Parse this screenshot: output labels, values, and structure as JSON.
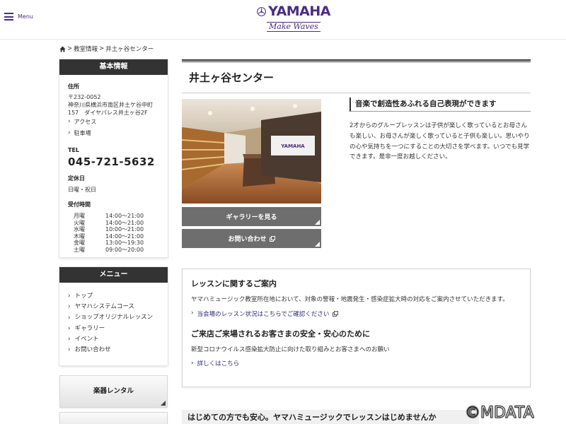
{
  "header": {
    "menu_label": "Menu",
    "logo_text": "YAMAHA",
    "logo_tagline": "Make Waves"
  },
  "breadcrumb": {
    "sep1": ">",
    "item1": "教室情報",
    "sep2": ">",
    "item2": "井土ヶ谷センター"
  },
  "sidebar": {
    "info_heading": "基本情報",
    "address_label": "住所",
    "address_lines": [
      "〒232-0052",
      "神奈川県横浜市南区井土ケ谷中町",
      "157　ダイヤパレス井土ヶ谷2F"
    ],
    "access_link": "アクセス",
    "parking_link": "駐車場",
    "tel_label": "TEL",
    "tel": "045-721-5632",
    "closed_label": "定休日",
    "closed_value": "日曜・祝日",
    "hours_label": "受付時間",
    "hours": [
      {
        "day": "月曜",
        "time": "14:00〜21:00"
      },
      {
        "day": "火曜",
        "time": "14:00〜21:00"
      },
      {
        "day": "水曜",
        "time": "10:00〜21:00"
      },
      {
        "day": "木曜",
        "time": "14:00〜21:00"
      },
      {
        "day": "金曜",
        "time": "13:00〜19:30"
      },
      {
        "day": "土曜",
        "time": "09:00〜20:00"
      }
    ],
    "menu_heading": "メニュー",
    "menu_items": [
      "トップ",
      "ヤマハシステムコース",
      "ショップオリジナルレッスン",
      "ギャラリー",
      "イベント",
      "お問い合わせ"
    ],
    "rental_button": "楽器レンタル"
  },
  "main": {
    "title": "井土ヶ谷センター",
    "gallery_button": "ギャラリーを見る",
    "contact_button": "お問い合わせ",
    "lead_heading": "音楽で創造性あふれる自己表現ができます",
    "lead_text": "2才からのグループレッスンは子供が楽しく歌っているとお母さんも楽しい、お母さんが楽しく歌っていると子供も楽しい。思いやりの心や気持ちを一つにすることの大切さを学べます。いつでも見学できます。是非一度お越しください。",
    "notice": {
      "heading1": "レッスンに関するご案内",
      "text1": "ヤマハミュージック教室所在地において、対象の警報・地震発生・感染症拡大時の対応をご案内させていただきます。",
      "link1": "当会場のレッスン状況はこちらでご確認ください",
      "heading2": "ご来店ご来場されるお客さまの安全・安心のために",
      "text2": "新型コロナウイルス感染拡大防止に向けた取り組みとお客さまへのお願い",
      "link2": "詳しくはこちら"
    },
    "bottom_banner": "はじめての方でも安心。ヤマハミュージックでレッスンはじめませんか"
  },
  "watermark": "©MDATA",
  "colors": {
    "brand_purple": "#4b2d83",
    "dark_heading": "#333333",
    "button_gray": "#6e6e6e",
    "link_navy": "#2b2b7a"
  }
}
